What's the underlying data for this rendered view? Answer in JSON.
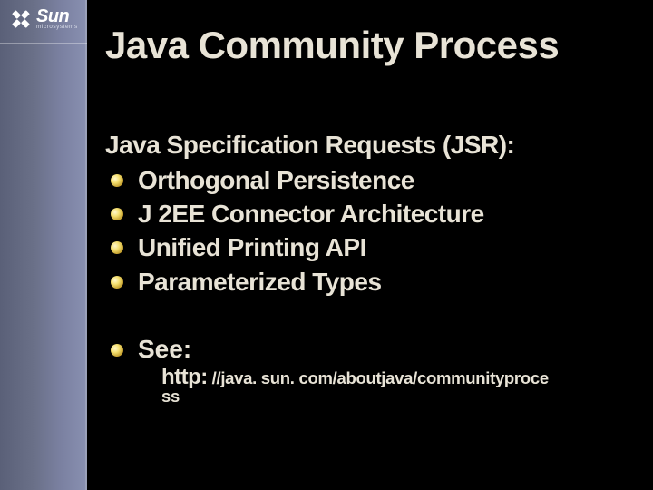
{
  "logo": {
    "brand": "Sun",
    "subbrand": "microsystems"
  },
  "title": "Java Community Process",
  "subtitle": "Java Specification Requests (JSR):",
  "bullets": [
    "Orthogonal Persistence",
    "J 2EE Connector Architecture",
    "Unified Printing API",
    "Parameterized Types"
  ],
  "see": {
    "label": "See:",
    "url_scheme": "http:",
    "url_rest": " //java. sun. com/aboutjava/communityproce",
    "url_tail": "ss"
  },
  "colors": {
    "accent_bullet": "#f5e070",
    "text": "#e8e3d6",
    "sidebar": "#6a7088"
  }
}
